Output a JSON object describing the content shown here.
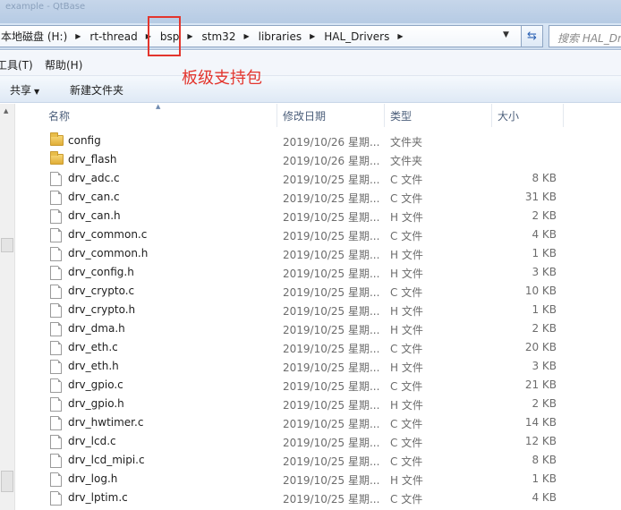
{
  "window": {
    "title_fragment": "example - QtBase"
  },
  "address": {
    "breadcrumbs": [
      "本地磁盘 (H:)",
      "rt-thread",
      "bsp",
      "stm32",
      "libraries",
      "HAL_Drivers"
    ],
    "search_placeholder": "搜索 HAL_Drivers"
  },
  "menu": {
    "tools": "工具(T)",
    "help": "帮助(H)"
  },
  "toolbar": {
    "share": "共享",
    "new_folder": "新建文件夹"
  },
  "annotation": {
    "text": "板级支持包",
    "color": "#e3352d"
  },
  "columns": {
    "name": "名称",
    "date": "修改日期",
    "type": "类型",
    "size": "大小"
  },
  "files": [
    {
      "name": "config",
      "date": "2019/10/26 星期...",
      "type": "文件夹",
      "size": "",
      "icon": "folder-icon"
    },
    {
      "name": "drv_flash",
      "date": "2019/10/26 星期...",
      "type": "文件夹",
      "size": "",
      "icon": "folder-icon"
    },
    {
      "name": "drv_adc.c",
      "date": "2019/10/25 星期...",
      "type": "C 文件",
      "size": "8 KB",
      "icon": "file-icon"
    },
    {
      "name": "drv_can.c",
      "date": "2019/10/25 星期...",
      "type": "C 文件",
      "size": "31 KB",
      "icon": "file-icon"
    },
    {
      "name": "drv_can.h",
      "date": "2019/10/25 星期...",
      "type": "H 文件",
      "size": "2 KB",
      "icon": "file-icon"
    },
    {
      "name": "drv_common.c",
      "date": "2019/10/25 星期...",
      "type": "C 文件",
      "size": "4 KB",
      "icon": "file-icon"
    },
    {
      "name": "drv_common.h",
      "date": "2019/10/25 星期...",
      "type": "H 文件",
      "size": "1 KB",
      "icon": "file-icon"
    },
    {
      "name": "drv_config.h",
      "date": "2019/10/25 星期...",
      "type": "H 文件",
      "size": "3 KB",
      "icon": "file-icon"
    },
    {
      "name": "drv_crypto.c",
      "date": "2019/10/25 星期...",
      "type": "C 文件",
      "size": "10 KB",
      "icon": "file-icon"
    },
    {
      "name": "drv_crypto.h",
      "date": "2019/10/25 星期...",
      "type": "H 文件",
      "size": "1 KB",
      "icon": "file-icon"
    },
    {
      "name": "drv_dma.h",
      "date": "2019/10/25 星期...",
      "type": "H 文件",
      "size": "2 KB",
      "icon": "file-icon"
    },
    {
      "name": "drv_eth.c",
      "date": "2019/10/25 星期...",
      "type": "C 文件",
      "size": "20 KB",
      "icon": "file-icon"
    },
    {
      "name": "drv_eth.h",
      "date": "2019/10/25 星期...",
      "type": "H 文件",
      "size": "3 KB",
      "icon": "file-icon"
    },
    {
      "name": "drv_gpio.c",
      "date": "2019/10/25 星期...",
      "type": "C 文件",
      "size": "21 KB",
      "icon": "file-icon"
    },
    {
      "name": "drv_gpio.h",
      "date": "2019/10/25 星期...",
      "type": "H 文件",
      "size": "2 KB",
      "icon": "file-icon"
    },
    {
      "name": "drv_hwtimer.c",
      "date": "2019/10/25 星期...",
      "type": "C 文件",
      "size": "14 KB",
      "icon": "file-icon"
    },
    {
      "name": "drv_lcd.c",
      "date": "2019/10/25 星期...",
      "type": "C 文件",
      "size": "12 KB",
      "icon": "file-icon"
    },
    {
      "name": "drv_lcd_mipi.c",
      "date": "2019/10/25 星期...",
      "type": "C 文件",
      "size": "8 KB",
      "icon": "file-icon"
    },
    {
      "name": "drv_log.h",
      "date": "2019/10/25 星期...",
      "type": "H 文件",
      "size": "1 KB",
      "icon": "file-icon"
    },
    {
      "name": "drv_lptim.c",
      "date": "2019/10/25 星期...",
      "type": "C 文件",
      "size": "4 KB",
      "icon": "file-icon"
    }
  ]
}
